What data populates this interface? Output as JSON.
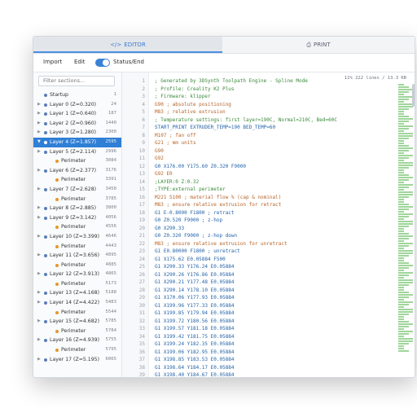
{
  "tabs": [
    {
      "label": "EDITOR",
      "icon": "code-icon"
    },
    {
      "label": "PRINT",
      "icon": "printer-icon"
    }
  ],
  "toolbar": {
    "import_label": "Import",
    "edit_label": "Edit",
    "toggle_on": true,
    "status_label": "Status/End"
  },
  "sidebar": {
    "filter_placeholder": "Filter sections...",
    "items": [
      {
        "label": "Startup",
        "value": "1",
        "level": 0
      },
      {
        "label": "Layer 0 (Z=0.320)",
        "value": "24",
        "level": 0
      },
      {
        "label": "Layer 1 (Z=0.640)",
        "value": "187",
        "level": 0
      },
      {
        "label": "Layer 2 (Z=0.960)",
        "value": "1440",
        "level": 0
      },
      {
        "label": "Layer 3 (Z=1.280)",
        "value": "2300",
        "level": 0
      },
      {
        "label": "Layer 4 (Z=1.857)",
        "value": "2595",
        "level": 0,
        "selected": true
      },
      {
        "label": "Layer 5 (Z=2.114)",
        "value": "2996",
        "level": 0
      },
      {
        "label": "Perimeter",
        "value": "3084",
        "level": 1
      },
      {
        "label": "Layer 6 (Z=2.377)",
        "value": "3176",
        "level": 0
      },
      {
        "label": "Perimeter",
        "value": "3391",
        "level": 1
      },
      {
        "label": "Layer 7 (Z=2.628)",
        "value": "3458",
        "level": 0
      },
      {
        "label": "Perimeter",
        "value": "3785",
        "level": 1
      },
      {
        "label": "Layer 8 (Z=2.885)",
        "value": "3800",
        "level": 0
      },
      {
        "label": "Layer 9 (Z=3.142)",
        "value": "4056",
        "level": 0
      },
      {
        "label": "Perimeter",
        "value": "4556",
        "level": 1
      },
      {
        "label": "Layer 10 (Z=3.399)",
        "value": "4646",
        "level": 0
      },
      {
        "label": "Perimeter",
        "value": "4443",
        "level": 1
      },
      {
        "label": "Layer 11 (Z=3.656)",
        "value": "4895",
        "level": 0
      },
      {
        "label": "Perimeter",
        "value": "4885",
        "level": 1
      },
      {
        "label": "Layer 12 (Z=3.913)",
        "value": "4865",
        "level": 0
      },
      {
        "label": "Perimeter",
        "value": "5173",
        "level": 1
      },
      {
        "label": "Layer 13 (Z=4.168)",
        "value": "5188",
        "level": 0
      },
      {
        "label": "Layer 14 (Z=4.422)",
        "value": "5483",
        "level": 0
      },
      {
        "label": "Perimeter",
        "value": "5544",
        "level": 1
      },
      {
        "label": "Layer 15 (Z=4.682)",
        "value": "5785",
        "level": 0
      },
      {
        "label": "Perimeter",
        "value": "5784",
        "level": 1
      },
      {
        "label": "Layer 16 (Z=4.939)",
        "value": "5755",
        "level": 0
      },
      {
        "label": "Perimeter",
        "value": "5795",
        "level": 1
      },
      {
        "label": "Layer 17 (Z=5.195)",
        "value": "6065",
        "level": 0
      }
    ]
  },
  "editor": {
    "stats": "11% 222 lines / 13.3 KB",
    "lines": [
      {
        "n": "1",
        "text": "; Generated by 3DSynth Toolpath Engine - Spline Mode",
        "kind": "c"
      },
      {
        "n": "2",
        "text": "; Profile: Creality K2 Plus",
        "kind": "c"
      },
      {
        "n": "3",
        "text": "; Firmware: klipper",
        "kind": "c"
      },
      {
        "n": "4",
        "text": "G90 ; absolute positioning",
        "kind": "k"
      },
      {
        "n": "5",
        "text": "M83 ; relative extrusion",
        "kind": "k"
      },
      {
        "n": "6",
        "text": "; Temperature settings: first layer=190C, Normal=210C, Bed=60C",
        "kind": "c"
      },
      {
        "n": "7",
        "text": "START_PRINT EXTRUDER_TEMP=190 BED_TEMP=60",
        "kind": "p"
      },
      {
        "n": "8",
        "text": "M107 ; fan off",
        "kind": "k"
      },
      {
        "n": "9",
        "text": "G21 ; mm units",
        "kind": "k"
      },
      {
        "n": "10",
        "text": "G90",
        "kind": "k"
      },
      {
        "n": "11",
        "text": "G92",
        "kind": "k"
      },
      {
        "n": "12",
        "text": "G0 X176.00 Y175.60 Z0.320 F9000",
        "kind": "p"
      },
      {
        "n": "13",
        "text": "G92 E0",
        "kind": "k"
      },
      {
        "n": "14",
        "text": ";LAYER:0 Z:0.32",
        "kind": "c"
      },
      {
        "n": "15",
        "text": ";TYPE:external perimeter",
        "kind": "c"
      },
      {
        "n": "16",
        "text": "M221 S100 ; material flow % (cap & nominal)",
        "kind": "k"
      },
      {
        "n": "17",
        "text": "M83 ; ensure relative extrusion for retract",
        "kind": "k"
      },
      {
        "n": "18",
        "text": "G1 E-0.8000 F1800 ; retract",
        "kind": "p"
      },
      {
        "n": "19",
        "text": "G0 Z0.520 F9000 ; z-hop",
        "kind": "p"
      },
      {
        "n": "20",
        "text": "G0 X290.33",
        "kind": "p"
      },
      {
        "n": "21",
        "text": "G0 Z0.320 F9000 ; z-hop down",
        "kind": "p"
      },
      {
        "n": "22",
        "text": "M83 ; ensure relative extrusion for unretract",
        "kind": "k"
      },
      {
        "n": "23",
        "text": "G1 E0.80000 F1800 ; unretract",
        "kind": "p"
      },
      {
        "n": "24",
        "text": "G1 X175.62 E0.05884 F500",
        "kind": "p"
      },
      {
        "n": "25",
        "text": "G1 X290.33 Y176.24 E0.05884",
        "kind": "p"
      },
      {
        "n": "26",
        "text": "G1 X290.26 Y176.86 E0.05884",
        "kind": "p"
      },
      {
        "n": "27",
        "text": "G1 X290.21 Y177.48 E0.05884",
        "kind": "p"
      },
      {
        "n": "28",
        "text": "G1 X290.14 Y178.10 E0.05884",
        "kind": "p"
      },
      {
        "n": "29",
        "text": "G1 X170.06 Y177.93 E0.05884",
        "kind": "p"
      },
      {
        "n": "30",
        "text": "G1 X199.96 Y177.33 E0.05884",
        "kind": "p"
      },
      {
        "n": "31",
        "text": "G1 X199.85 Y179.94 E0.05884",
        "kind": "p"
      },
      {
        "n": "32",
        "text": "G1 X199.72 Y180.56 E0.05884",
        "kind": "p"
      },
      {
        "n": "33",
        "text": "G1 X199.57 Y181.18 E0.05884",
        "kind": "p"
      },
      {
        "n": "34",
        "text": "G1 X199.42 Y181.75 E0.05884",
        "kind": "p"
      },
      {
        "n": "35",
        "text": "G1 X199.24 Y182.35 E0.05884",
        "kind": "p"
      },
      {
        "n": "36",
        "text": "G1 X199.06 Y182.95 E0.05884",
        "kind": "p"
      },
      {
        "n": "37",
        "text": "G1 X198.85 Y183.53 E0.05884",
        "kind": "p"
      },
      {
        "n": "38",
        "text": "G1 X198.64 Y184.17 E0.05884",
        "kind": "p"
      },
      {
        "n": "39",
        "text": "G1 X198.40 Y184.67 E0.05884",
        "kind": "p"
      }
    ]
  },
  "colors": {
    "accent": "#2f7fd6",
    "comment": "#3a8a3a",
    "keyword": "#b6642a",
    "code": "#2563a8"
  }
}
